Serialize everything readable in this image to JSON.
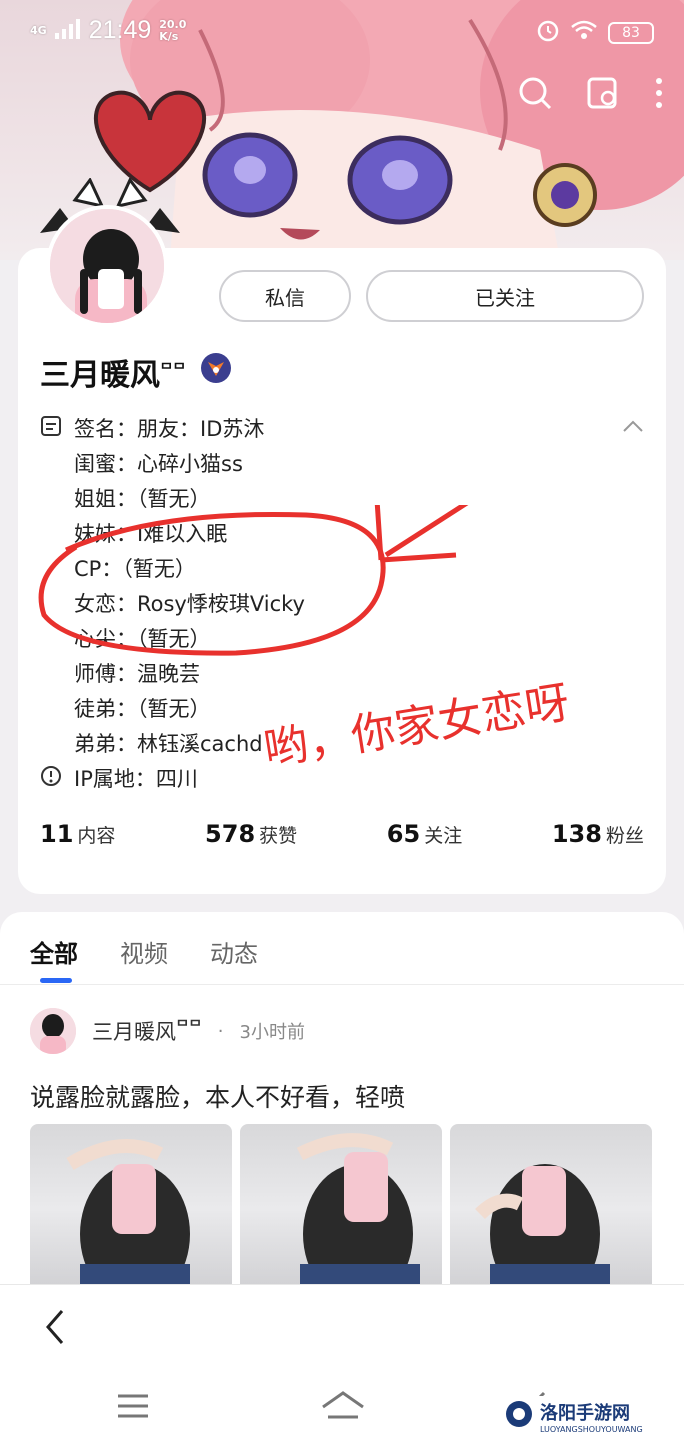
{
  "status": {
    "network": "4G",
    "time": "21:49",
    "speed": "20.0",
    "speed_unit": "K/s",
    "battery": "83"
  },
  "profile": {
    "name": "三月暖风",
    "level": "ᄆᄆ",
    "buttons": {
      "message": "私信",
      "follow": "已关注"
    },
    "info": [
      {
        "label": "签名：",
        "value": "朋友：ID苏沐",
        "icon": "note-icon"
      },
      {
        "label": "闺蜜：",
        "value": "心碎小猫ss"
      },
      {
        "label": "姐姐：",
        "value": "（暂无）"
      },
      {
        "label": "妹妹：",
        "value": "I难以入眠"
      },
      {
        "label": "CP：",
        "value": "（暂无）"
      },
      {
        "label": "女恋：",
        "value": "Rosy悸桉琪Vicky"
      },
      {
        "label": "心尖：",
        "value": "（暂无）"
      },
      {
        "label": "师傅：",
        "value": "温晚芸"
      },
      {
        "label": "徒弟：",
        "value": "（暂无）"
      },
      {
        "label": "弟弟：",
        "value": "林钰溪cachd"
      }
    ],
    "ip": {
      "label": "IP属地：",
      "value": "四川"
    },
    "stats": [
      {
        "num": "11",
        "label": "内容"
      },
      {
        "num": "578",
        "label": "获赞"
      },
      {
        "num": "65",
        "label": "关注"
      },
      {
        "num": "138",
        "label": "粉丝"
      }
    ]
  },
  "annotation": {
    "text": "哟，你家女恋呀",
    "color": "#e8312d"
  },
  "tabs": [
    "全部",
    "视频",
    "动态"
  ],
  "post": {
    "author": "三月暖风",
    "level": "ᄆᄆ",
    "dot": "·",
    "time": "3小时前",
    "text": "说露脸就露脸，本人不好看，轻喷"
  },
  "watermark": {
    "title": "洛阳手游网",
    "sub": "LUOYANGSHOUYOUWANG"
  },
  "colors": {
    "accent": "#2a67f5",
    "annotation": "#e8312d"
  }
}
